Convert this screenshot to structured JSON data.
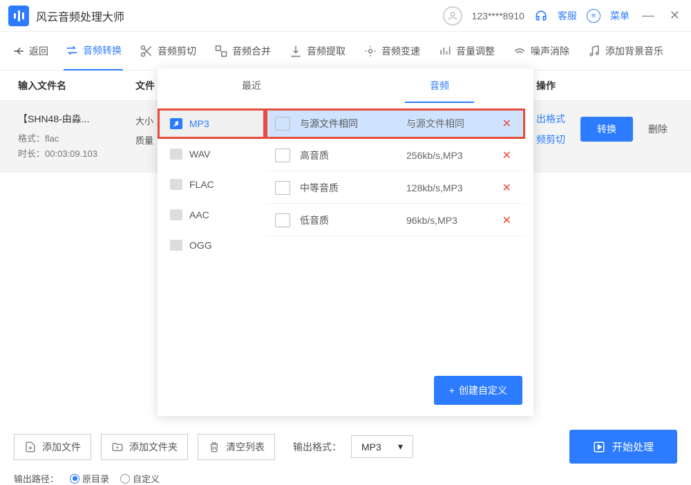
{
  "app": {
    "title": "风云音频处理大师"
  },
  "titlebar": {
    "user_id": "123****8910",
    "support": "客服",
    "menu": "菜单"
  },
  "toolbar": {
    "back": "返回",
    "tabs": [
      {
        "label": "音频转换",
        "active": true
      },
      {
        "label": "音频剪切"
      },
      {
        "label": "音频合并"
      },
      {
        "label": "音频提取"
      },
      {
        "label": "音频变速"
      },
      {
        "label": "音量调整"
      },
      {
        "label": "噪声消除"
      },
      {
        "label": "添加背景音乐"
      }
    ]
  },
  "table": {
    "col_name": "输入文件名",
    "col_info": "文件",
    "col_ops": "操作"
  },
  "file": {
    "title": "【SHN48-由淼...",
    "format_label": "格式：",
    "format_val": "flac",
    "duration_label": "时长：",
    "duration_val": "00:03:09.103",
    "size_label": "大小",
    "quality_label": "质量",
    "out_format_link": "出格式",
    "clip_link": "频剪切",
    "convert": "转换",
    "delete": "删除"
  },
  "dropdown": {
    "tab_recent": "最近",
    "tab_audio": "音频",
    "formats": [
      {
        "label": "MP3"
      },
      {
        "label": "WAV"
      },
      {
        "label": "FLAC"
      },
      {
        "label": "AAC"
      },
      {
        "label": "OGG"
      }
    ],
    "qualities": [
      {
        "name": "与源文件相同",
        "value": "与源文件相同"
      },
      {
        "name": "高音质",
        "value": "256kb/s,MP3"
      },
      {
        "name": "中等音质",
        "value": "128kb/s,MP3"
      },
      {
        "name": "低音质",
        "value": "96kb/s,MP3"
      }
    ],
    "create_custom": "创建自定义"
  },
  "bottombar": {
    "add_file": "添加文件",
    "add_folder": "添加文件夹",
    "clear_list": "清空列表",
    "out_format": "输出格式：",
    "selected": "MP3",
    "start": "开始处理",
    "out_path": "输出路径：",
    "radio_original": "原目录",
    "radio_custom": "自定义"
  }
}
